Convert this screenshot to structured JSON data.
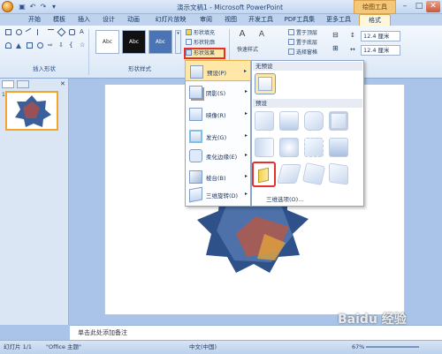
{
  "window": {
    "title": "演示文稿1 - Microsoft PowerPoint",
    "context_tool": "绘图工具"
  },
  "menu": {
    "tabs": [
      "开始",
      "模板",
      "插入",
      "设计",
      "动画",
      "幻灯片放映",
      "审阅",
      "视图",
      "开发工具",
      "PDF工具集",
      "更多工具",
      "格式"
    ]
  },
  "ribbon": {
    "groups": {
      "insert_shapes": "插入形状",
      "shape_styles": "形状样式"
    },
    "style_thumbnails": [
      "Abc",
      "Abc",
      "Abc"
    ],
    "shape_fill": "形状填充",
    "shape_outline": "形状轮廓",
    "shape_effects": "形状效果",
    "quick_styles": "快速样式",
    "bring_forward": "置于顶层",
    "send_backward": "置于底层",
    "selection_pane": "选择窗格",
    "height": "12.4 厘米",
    "width": "12.4 厘米"
  },
  "dropdown": {
    "items": [
      {
        "label": "预设(P)",
        "arrow": "▸"
      },
      {
        "label": "阴影(S)",
        "arrow": "▸"
      },
      {
        "label": "映像(R)",
        "arrow": "▸"
      },
      {
        "label": "发光(G)",
        "arrow": "▸"
      },
      {
        "label": "柔化边缘(E)",
        "arrow": "▸"
      },
      {
        "label": "棱台(B)",
        "arrow": "▸"
      },
      {
        "label": "三维旋转(D)",
        "arrow": "▸"
      }
    ]
  },
  "gallery": {
    "none_header": "无预设",
    "preset_header": "预设",
    "footer": "三维选项(O)..."
  },
  "notes": {
    "placeholder": "单击此处添加备注"
  },
  "status": {
    "slide": "幻灯片 1/1",
    "theme": "\"Office 主题\"",
    "lang": "中文(中国)",
    "zoom": "67%"
  },
  "colors": {
    "accent": "#e4312b",
    "ribbon": "#dbe7f6",
    "highlight": "#ffe7a8"
  }
}
